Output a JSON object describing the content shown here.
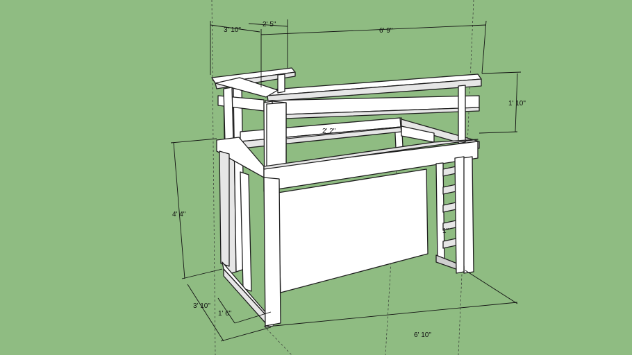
{
  "viewport": {
    "background": "#8fbc82",
    "model": "loft bed frame"
  },
  "dimensions": {
    "top_depth": "3' 10\"",
    "top_short": "2' 5\"",
    "top_length": "6' 9\"",
    "rail_height": "1' 10\"",
    "inner_span": "2' 2\"",
    "total_height": "4' 4\"",
    "base_depth": "3' 10\"",
    "base_inner": "1' 6\"",
    "base_length": "6' 10\"",
    "ladder_tick": "1\""
  }
}
